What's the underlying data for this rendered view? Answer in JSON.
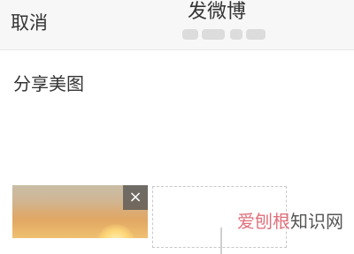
{
  "header": {
    "cancel_label": "取消",
    "title": "发微博"
  },
  "compose": {
    "text": "分享美图"
  },
  "images": {
    "remove_glyph": "×"
  },
  "watermark": {
    "part1": "爱刨根",
    "part2": "知识网"
  },
  "colors": {
    "header_bg": "#f7f7f7",
    "text": "#333333",
    "watermark_accent": "#e0707c"
  }
}
